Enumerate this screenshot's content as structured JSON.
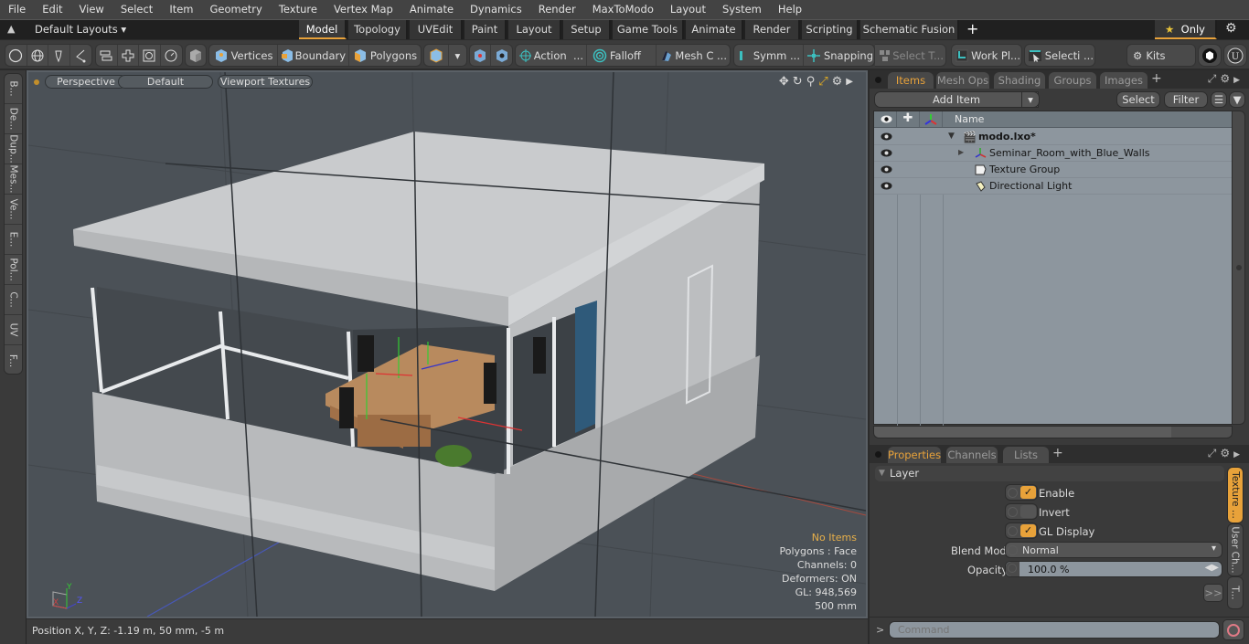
{
  "menu": [
    "File",
    "Edit",
    "View",
    "Select",
    "Item",
    "Geometry",
    "Texture",
    "Vertex Map",
    "Animate",
    "Dynamics",
    "Render",
    "MaxToModo",
    "Layout",
    "System",
    "Help"
  ],
  "layouts": {
    "dropdown_label": "Default Layouts",
    "tabs": [
      "Model",
      "Topology",
      "UVEdit",
      "Paint",
      "Layout",
      "Setup",
      "Game Tools",
      "Animate",
      "Render",
      "Scripting",
      "Schematic Fusion"
    ],
    "active_tab": "Model",
    "add_label": "+",
    "only_label": "Only"
  },
  "toolbar": {
    "vertices": "Vertices",
    "boundary": "Boundary",
    "polygons": "Polygons",
    "action": "Action",
    "action_more": "...",
    "falloff": "Falloff",
    "mesh_c": "Mesh C ...",
    "symm": "Symm ...",
    "snapping": "Snapping",
    "select_t": "Select T...",
    "work_pl": "Work Pl...",
    "selecti": "Selecti ...",
    "kits": "Kits"
  },
  "left_tabs": [
    "B...",
    "De...",
    "Dup...",
    "Mes...",
    "Ve...",
    "E...",
    "Pol...",
    "C...",
    "UV",
    "F..."
  ],
  "viewport": {
    "projection": "Perspective",
    "shading": "Default",
    "textures": "Viewport Textures",
    "info": {
      "selection": "No Items",
      "polygons": "Polygons : Face",
      "channels": "Channels: 0",
      "deformers": "Deformers: ON",
      "gl": "GL: 948,569",
      "scale": "500 mm"
    },
    "axis_labels": {
      "x": "X",
      "y": "Y",
      "z": "Z"
    }
  },
  "status": {
    "position": "Position X, Y, Z:   -1.19 m, 50 mm, -5 m"
  },
  "items_panel": {
    "tabs": [
      "Items",
      "Mesh Ops",
      "Shading",
      "Groups",
      "Images"
    ],
    "active_tab": "Items",
    "add_item": "Add Item",
    "select": "Select",
    "filter": "Filter",
    "column_name": "Name",
    "rows": [
      {
        "name": "modo.lxo*",
        "type": "scene"
      },
      {
        "name": "Seminar_Room_with_Blue_Walls",
        "type": "mesh"
      },
      {
        "name": "Texture Group",
        "type": "texture-group"
      },
      {
        "name": "Directional Light",
        "type": "light"
      }
    ]
  },
  "properties_panel": {
    "tabs": [
      "Properties",
      "Channels",
      "Lists"
    ],
    "active_tab": "Properties",
    "section": "Layer",
    "enable_label": "Enable",
    "enable": true,
    "invert_label": "Invert",
    "invert": false,
    "gl_display_label": "GL Display",
    "gl_display": true,
    "blend_mode_label": "Blend Mode",
    "blend_mode": "Normal",
    "opacity_label": "Opacity",
    "opacity": "100.0 %",
    "more": ">>",
    "side_tabs": [
      "Texture ...",
      "User Ch...",
      "T..."
    ]
  },
  "command": {
    "prompt": ">",
    "placeholder": "Command"
  },
  "colors": {
    "accent": "#e8a23a",
    "viewport_bg": "#4b5157",
    "list_bg": "#8d969e"
  }
}
